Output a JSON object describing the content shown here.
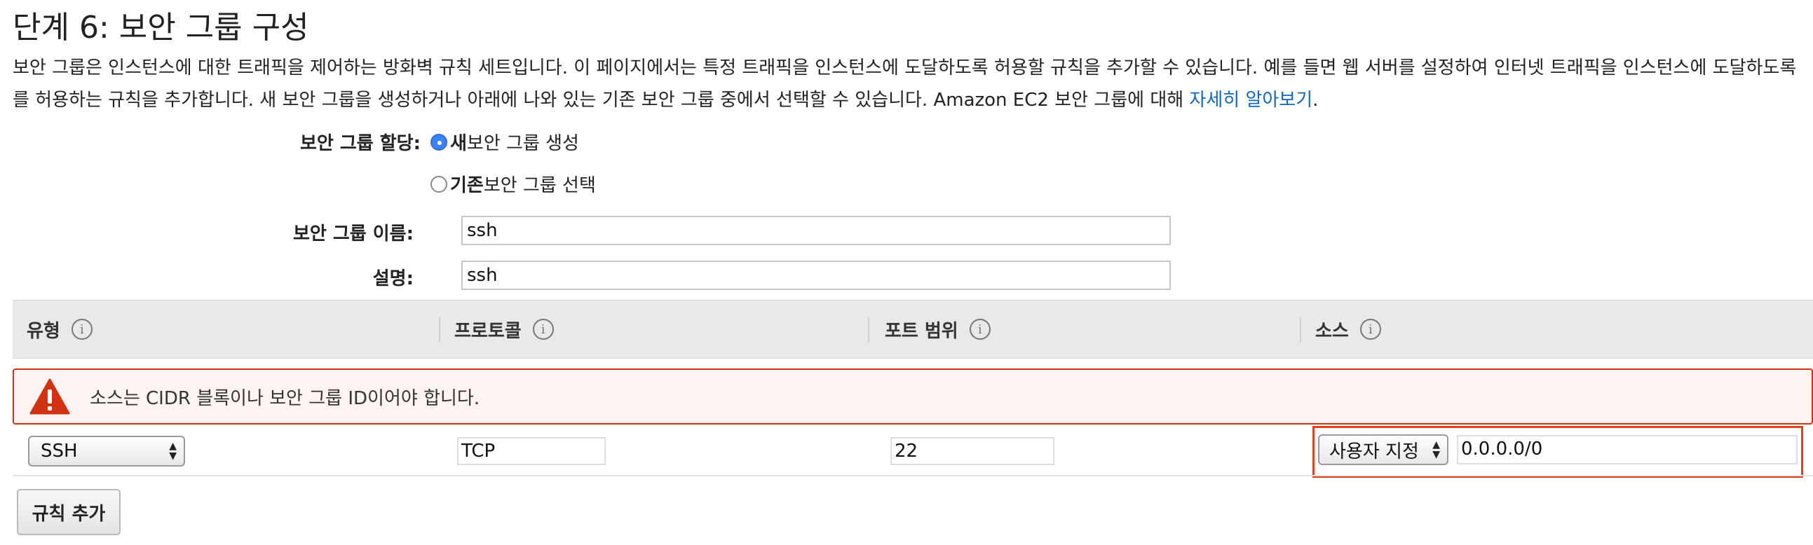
{
  "page": {
    "title": "단계 6: 보안 그룹 구성",
    "intro": "보안 그룹은 인스턴스에 대한 트래픽을 제어하는 방화벽 규칙 세트입니다. 이 페이지에서는 특정 트래픽을 인스턴스에 도달하도록 허용할 규칙을 추가할 수 있습니다. 예를 들면 웹 서버를 설정하여 인터넷 트래픽을 인스턴스에 도달하도록 를 허용하는 규칙을 추가합니다. 새 보안 그룹을 생성하거나 아래에 나와 있는 기존 보안 그룹 중에서 선택할 수 있습니다. Amazon EC2 보안 그룹에 대해 ",
    "learn_more": "자세히 알아보기",
    "intro_end": "."
  },
  "form": {
    "assign_label": "보안 그룹 할당:",
    "option_new_bold": "새",
    "option_new_rest": " 보안 그룹 생성",
    "option_existing_bold": "기존",
    "option_existing_rest": " 보안 그룹 선택",
    "selected_option": "new",
    "name_label": "보안 그룹 이름:",
    "name_value": "ssh",
    "desc_label": "설명:",
    "desc_value": "ssh"
  },
  "table": {
    "columns": [
      {
        "label": "유형"
      },
      {
        "label": "프로토콜"
      },
      {
        "label": "포트 범위"
      },
      {
        "label": "소스"
      }
    ],
    "info_glyph": "i",
    "alert_text": "소스는 CIDR 블록이나 보안 그룹 ID이어야 합니다.",
    "row": {
      "type": "SSH",
      "protocol": "TCP",
      "port_range": "22",
      "source_select": "사용자 지정",
      "source_value": "0.0.0.0/0"
    },
    "add_rule_label": "규칙 추가"
  },
  "colors": {
    "accent": "#3b82f6",
    "error": "#d13212",
    "link": "#1166bb"
  }
}
